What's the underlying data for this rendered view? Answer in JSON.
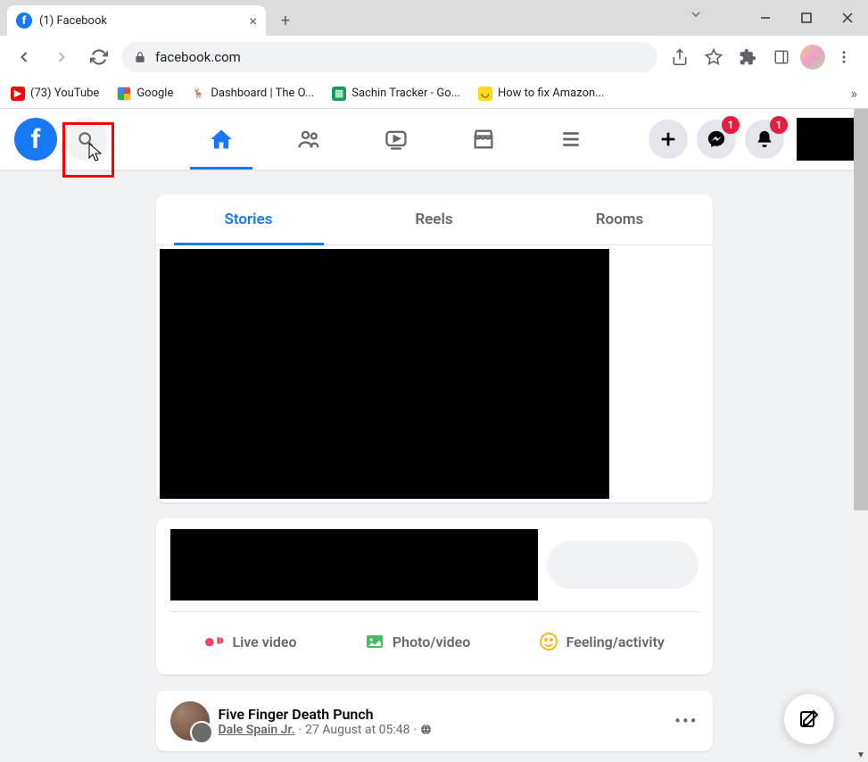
{
  "browser": {
    "tab_title": "(1) Facebook",
    "url": "facebook.com",
    "bookmarks": [
      {
        "label": "(73) YouTube",
        "icon": "yt"
      },
      {
        "label": "Google",
        "icon": "g"
      },
      {
        "label": "Dashboard | The O...",
        "icon": "d"
      },
      {
        "label": "Sachin Tracker - Go...",
        "icon": "s"
      },
      {
        "label": "How to fix Amazon...",
        "icon": "a"
      }
    ]
  },
  "header": {
    "messenger_badge": "1",
    "notifications_badge": "1"
  },
  "feed_tabs": {
    "stories": "Stories",
    "reels": "Reels",
    "rooms": "Rooms"
  },
  "composer": {
    "live_video": "Live video",
    "photo_video": "Photo/video",
    "feeling": "Feeling/activity"
  },
  "post": {
    "name": "Five Finger Death Punch",
    "author": "Dale Spain Jr.",
    "timestamp": "27 August at 05:48",
    "separator": " · "
  }
}
